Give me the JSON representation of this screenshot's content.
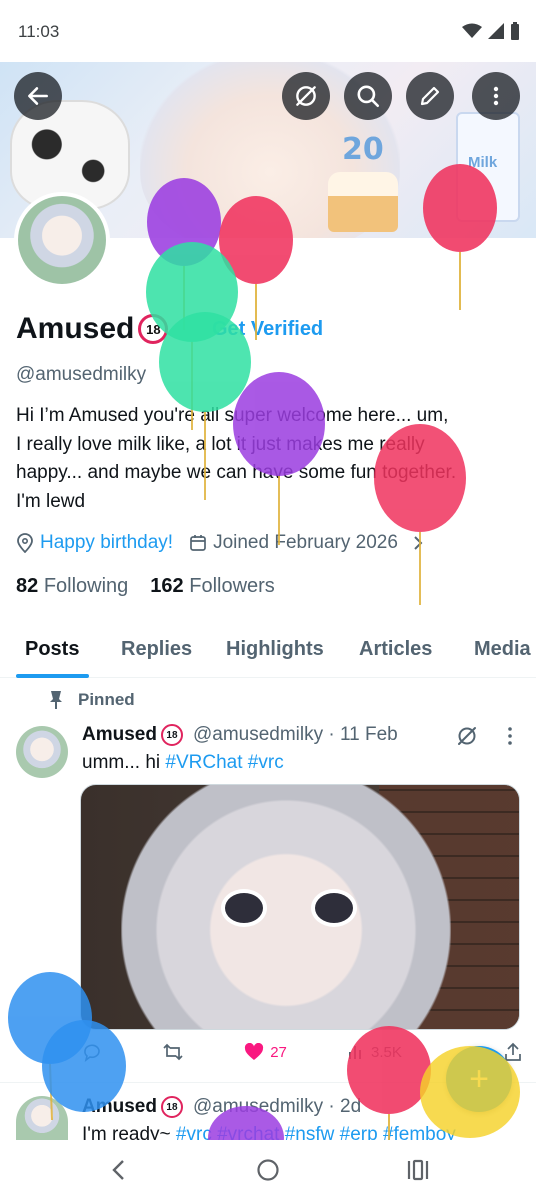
{
  "status_bar": {
    "time": "11:03"
  },
  "profile": {
    "name": "Amused",
    "badge": "18",
    "verify_cta": "Get Verified",
    "handle": "@amusedmilky",
    "bio": "Hi I’m Amused you're all super welcome here... um,\nI really love milk like, a lot it just makes me really\nhappy... and maybe we can have some fun together.\nI'm lewd",
    "location": "Happy birthday!",
    "joined": "Joined February 2026",
    "following_count": "82",
    "following_label": "Following",
    "followers_count": "162",
    "followers_label": "Followers"
  },
  "banner": {
    "number": "20",
    "milk_label": "Milk"
  },
  "tabs": [
    {
      "label": "Posts"
    },
    {
      "label": "Replies"
    },
    {
      "label": "Highlights"
    },
    {
      "label": "Articles"
    },
    {
      "label": "Media"
    }
  ],
  "pinned_label": "Pinned",
  "posts": [
    {
      "name": "Amused",
      "badge": "18",
      "handle": "@amusedmilky · 11 Feb",
      "text_prefix": "umm... hi ",
      "hashtags": [
        "#VRChat",
        "#vrc"
      ],
      "actions": {
        "likes": "27",
        "views": "3.5K"
      }
    },
    {
      "name": "Amused",
      "badge": "18",
      "handle": "@amusedmilky · 2d",
      "text_prefix": "I'm ready~ ",
      "hashtags": [
        "#vrc",
        "#vrchat",
        "#nsfw",
        "#erp",
        "#femboy"
      ]
    }
  ],
  "fab": {
    "label": "+"
  },
  "colors": {
    "accent": "#1d9bf0",
    "like": "#f91880",
    "badge_ring": "#e0245e"
  }
}
